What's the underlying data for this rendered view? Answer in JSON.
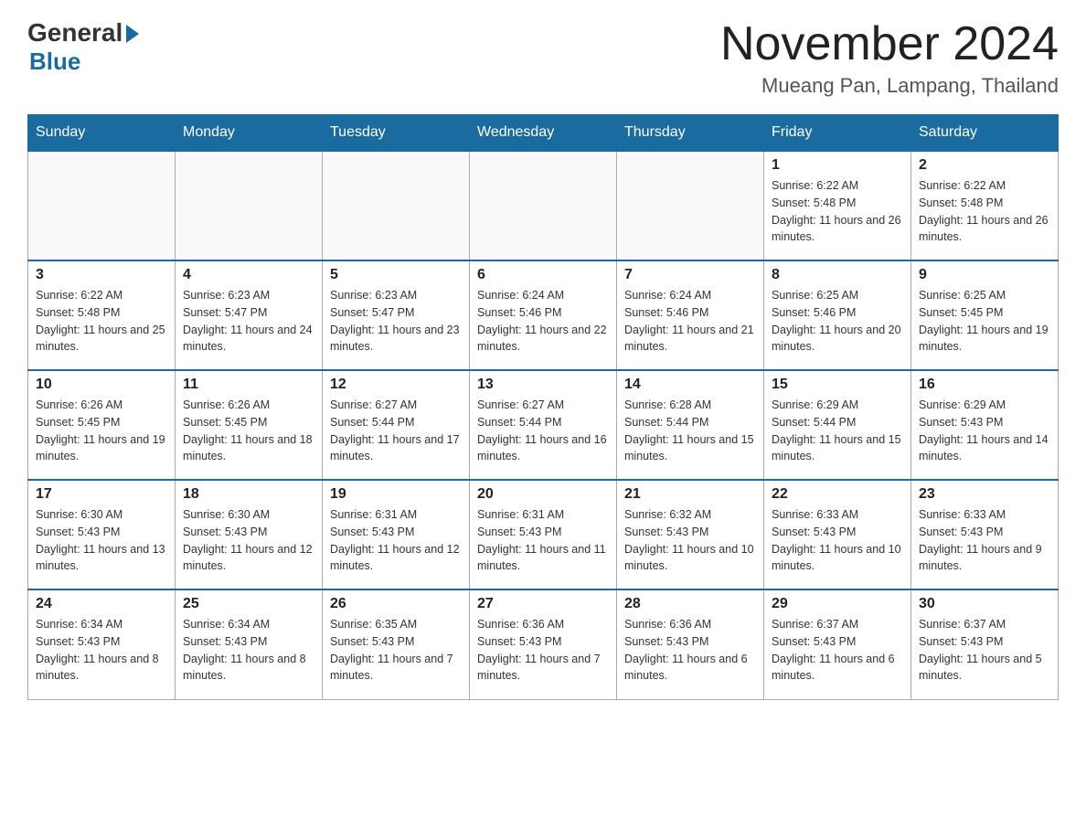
{
  "logo": {
    "general": "General",
    "blue": "Blue"
  },
  "header": {
    "month": "November 2024",
    "location": "Mueang Pan, Lampang, Thailand"
  },
  "weekdays": [
    "Sunday",
    "Monday",
    "Tuesday",
    "Wednesday",
    "Thursday",
    "Friday",
    "Saturday"
  ],
  "weeks": [
    [
      {
        "day": "",
        "info": ""
      },
      {
        "day": "",
        "info": ""
      },
      {
        "day": "",
        "info": ""
      },
      {
        "day": "",
        "info": ""
      },
      {
        "day": "",
        "info": ""
      },
      {
        "day": "1",
        "info": "Sunrise: 6:22 AM\nSunset: 5:48 PM\nDaylight: 11 hours and 26 minutes."
      },
      {
        "day": "2",
        "info": "Sunrise: 6:22 AM\nSunset: 5:48 PM\nDaylight: 11 hours and 26 minutes."
      }
    ],
    [
      {
        "day": "3",
        "info": "Sunrise: 6:22 AM\nSunset: 5:48 PM\nDaylight: 11 hours and 25 minutes."
      },
      {
        "day": "4",
        "info": "Sunrise: 6:23 AM\nSunset: 5:47 PM\nDaylight: 11 hours and 24 minutes."
      },
      {
        "day": "5",
        "info": "Sunrise: 6:23 AM\nSunset: 5:47 PM\nDaylight: 11 hours and 23 minutes."
      },
      {
        "day": "6",
        "info": "Sunrise: 6:24 AM\nSunset: 5:46 PM\nDaylight: 11 hours and 22 minutes."
      },
      {
        "day": "7",
        "info": "Sunrise: 6:24 AM\nSunset: 5:46 PM\nDaylight: 11 hours and 21 minutes."
      },
      {
        "day": "8",
        "info": "Sunrise: 6:25 AM\nSunset: 5:46 PM\nDaylight: 11 hours and 20 minutes."
      },
      {
        "day": "9",
        "info": "Sunrise: 6:25 AM\nSunset: 5:45 PM\nDaylight: 11 hours and 19 minutes."
      }
    ],
    [
      {
        "day": "10",
        "info": "Sunrise: 6:26 AM\nSunset: 5:45 PM\nDaylight: 11 hours and 19 minutes."
      },
      {
        "day": "11",
        "info": "Sunrise: 6:26 AM\nSunset: 5:45 PM\nDaylight: 11 hours and 18 minutes."
      },
      {
        "day": "12",
        "info": "Sunrise: 6:27 AM\nSunset: 5:44 PM\nDaylight: 11 hours and 17 minutes."
      },
      {
        "day": "13",
        "info": "Sunrise: 6:27 AM\nSunset: 5:44 PM\nDaylight: 11 hours and 16 minutes."
      },
      {
        "day": "14",
        "info": "Sunrise: 6:28 AM\nSunset: 5:44 PM\nDaylight: 11 hours and 15 minutes."
      },
      {
        "day": "15",
        "info": "Sunrise: 6:29 AM\nSunset: 5:44 PM\nDaylight: 11 hours and 15 minutes."
      },
      {
        "day": "16",
        "info": "Sunrise: 6:29 AM\nSunset: 5:43 PM\nDaylight: 11 hours and 14 minutes."
      }
    ],
    [
      {
        "day": "17",
        "info": "Sunrise: 6:30 AM\nSunset: 5:43 PM\nDaylight: 11 hours and 13 minutes."
      },
      {
        "day": "18",
        "info": "Sunrise: 6:30 AM\nSunset: 5:43 PM\nDaylight: 11 hours and 12 minutes."
      },
      {
        "day": "19",
        "info": "Sunrise: 6:31 AM\nSunset: 5:43 PM\nDaylight: 11 hours and 12 minutes."
      },
      {
        "day": "20",
        "info": "Sunrise: 6:31 AM\nSunset: 5:43 PM\nDaylight: 11 hours and 11 minutes."
      },
      {
        "day": "21",
        "info": "Sunrise: 6:32 AM\nSunset: 5:43 PM\nDaylight: 11 hours and 10 minutes."
      },
      {
        "day": "22",
        "info": "Sunrise: 6:33 AM\nSunset: 5:43 PM\nDaylight: 11 hours and 10 minutes."
      },
      {
        "day": "23",
        "info": "Sunrise: 6:33 AM\nSunset: 5:43 PM\nDaylight: 11 hours and 9 minutes."
      }
    ],
    [
      {
        "day": "24",
        "info": "Sunrise: 6:34 AM\nSunset: 5:43 PM\nDaylight: 11 hours and 8 minutes."
      },
      {
        "day": "25",
        "info": "Sunrise: 6:34 AM\nSunset: 5:43 PM\nDaylight: 11 hours and 8 minutes."
      },
      {
        "day": "26",
        "info": "Sunrise: 6:35 AM\nSunset: 5:43 PM\nDaylight: 11 hours and 7 minutes."
      },
      {
        "day": "27",
        "info": "Sunrise: 6:36 AM\nSunset: 5:43 PM\nDaylight: 11 hours and 7 minutes."
      },
      {
        "day": "28",
        "info": "Sunrise: 6:36 AM\nSunset: 5:43 PM\nDaylight: 11 hours and 6 minutes."
      },
      {
        "day": "29",
        "info": "Sunrise: 6:37 AM\nSunset: 5:43 PM\nDaylight: 11 hours and 6 minutes."
      },
      {
        "day": "30",
        "info": "Sunrise: 6:37 AM\nSunset: 5:43 PM\nDaylight: 11 hours and 5 minutes."
      }
    ]
  ]
}
